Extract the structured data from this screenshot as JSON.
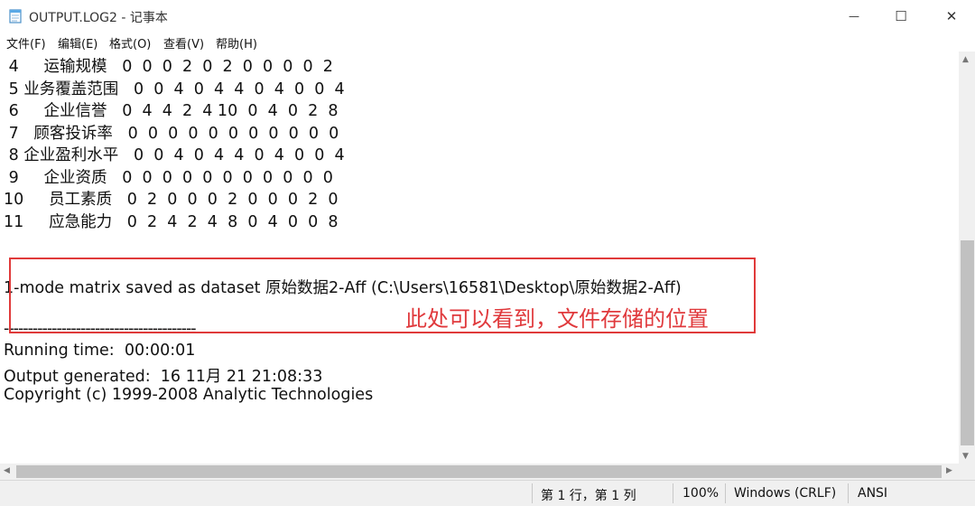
{
  "window": {
    "title": "OUTPUT.LOG2 - 记事本",
    "minimize_glyph": "—",
    "maximize_glyph": "☐",
    "close_glyph": "✕"
  },
  "menu": {
    "file": "文件(F)",
    "edit": "编辑(E)",
    "format": "格式(O)",
    "view": "查看(V)",
    "help": "帮助(H)"
  },
  "content": {
    "lines": [
      " 4     运输规模   0  0  0  2  0  2  0  0  0  0  2",
      " 5 业务覆盖范围   0  0  4  0  4  4  0  4  0  0  4",
      " 6     企业信誉   0  4  4  2  4 10  0  4  0  2  8",
      " 7   顾客投诉率   0  0  0  0  0  0  0  0  0  0  0",
      " 8 企业盈利水平   0  0  4  0  4  4  0  4  0  0  4",
      " 9     企业资质   0  0  0  0  0  0  0  0  0  0  0",
      "10     员工素质   0  2  0  0  0  2  0  0  0  2  0",
      "11     应急能力   0  2  4  2  4  8  0  4  0  0  8",
      "",
      "1-mode matrix saved as dataset 原始数据2-Aff (C:\\Users\\16581\\Desktop\\原始数据2-Aff)",
      "",
      "----------------------------------------",
      "Running time:  00:00:01",
      "Output generated:  16 11月 21 21:08:33",
      "Copyright (c) 1999-2008 Analytic Technologies"
    ]
  },
  "annotation": {
    "text": "此处可以看到，文件存储的位置",
    "color": "#e0393c"
  },
  "status": {
    "position": "第 1 行，第 1 列",
    "zoom": "100%",
    "line_ending": "Windows (CRLF)",
    "encoding": "ANSI"
  }
}
